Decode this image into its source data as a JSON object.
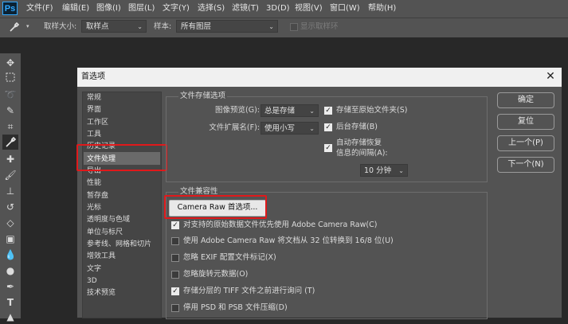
{
  "app": {
    "logo": "Ps"
  },
  "menubar": {
    "items": [
      "文件(F)",
      "编辑(E)",
      "图像(I)",
      "图层(L)",
      "文字(Y)",
      "选择(S)",
      "滤镜(T)",
      "3D(D)",
      "视图(V)",
      "窗口(W)",
      "帮助(H)"
    ]
  },
  "options_bar": {
    "sample_size_label": "取样大小:",
    "sample_size_value": "取样点",
    "sample_label": "样本:",
    "sample_value": "所有图层",
    "show_ring_label": "显示取样环"
  },
  "dialog": {
    "title": "首选项",
    "categories": [
      "常规",
      "界面",
      "工作区",
      "工具",
      "历史记录",
      "文件处理",
      "导出",
      "性能",
      "暂存盘",
      "光标",
      "透明度与色域",
      "单位与标尺",
      "参考线、网格和切片",
      "增效工具",
      "文字",
      "3D",
      "技术预览"
    ],
    "selected_category": "文件处理",
    "file_saving": {
      "title": "文件存储选项",
      "image_preview_label": "图像预览(G):",
      "image_preview_value": "总是存储",
      "file_ext_label": "文件扩展名(F):",
      "file_ext_value": "使用小写",
      "save_to_original_label": "存储至原始文件夹(S)",
      "save_to_original_checked": true,
      "background_save_label": "后台存储(B)",
      "background_save_checked": true,
      "auto_save_label_1": "自动存储恢复",
      "auto_save_label_2": "信息的间隔(A):",
      "auto_save_checked": true,
      "auto_save_interval": "10 分钟"
    },
    "compat": {
      "title": "文件兼容性",
      "camera_raw_button": "Camera Raw 首选项...",
      "options": [
        {
          "label": "对支持的原始数据文件优先使用 Adobe Camera Raw(C)",
          "checked": true
        },
        {
          "label": "使用 Adobe Camera Raw 将文档从 32 位转换到 16/8 位(U)",
          "checked": false
        },
        {
          "label": "忽略 EXIF 配置文件标记(X)",
          "checked": false
        },
        {
          "label": "忽略旋转元数据(O)",
          "checked": false
        },
        {
          "label": "存储分层的 TIFF 文件之前进行询问 (T)",
          "checked": true
        },
        {
          "label": "停用 PSD 和 PSB 文件压缩(D)",
          "checked": false
        }
      ]
    },
    "buttons": {
      "ok": "确定",
      "reset": "复位",
      "prev": "上一个(P)",
      "next": "下一个(N)"
    }
  }
}
